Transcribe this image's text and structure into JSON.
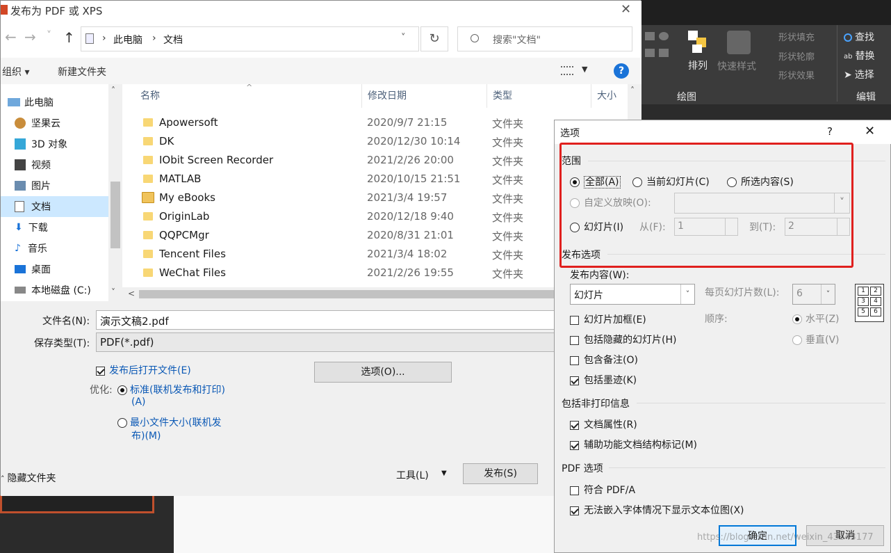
{
  "save_dialog": {
    "title": "发布为 PDF 或 XPS",
    "close": "✕",
    "nav_back": "←",
    "nav_forward": "→",
    "nav_recent": "˅",
    "nav_up": "↑",
    "breadcrumb": [
      "此电脑",
      "文档"
    ],
    "breadcrumb_sep": "›",
    "refresh": "↻",
    "search_placeholder": "搜索\"文档\"",
    "organize": "组织 ▾",
    "new_folder": "新建文件夹",
    "help": "?",
    "nav_items": [
      "此电脑",
      "坚果云",
      "3D 对象",
      "视频",
      "图片",
      "文档",
      "下载",
      "音乐",
      "桌面",
      "本地磁盘 (C:)"
    ],
    "columns": {
      "name": "名称",
      "date": "修改日期",
      "type": "类型",
      "size": "大小"
    },
    "files": [
      {
        "name": "Apowersoft",
        "date": "2020/9/7 21:15",
        "type": "文件夹"
      },
      {
        "name": "DK",
        "date": "2020/12/30 10:14",
        "type": "文件夹"
      },
      {
        "name": "IObit Screen Recorder",
        "date": "2021/2/26 20:00",
        "type": "文件夹"
      },
      {
        "name": "MATLAB",
        "date": "2020/10/15 21:51",
        "type": "文件夹"
      },
      {
        "name": "My eBooks",
        "date": "2021/3/4 19:57",
        "type": "文件夹"
      },
      {
        "name": "OriginLab",
        "date": "2020/12/18 9:40",
        "type": "文件夹"
      },
      {
        "name": "QQPCMgr",
        "date": "2020/8/31 21:01",
        "type": "文件夹"
      },
      {
        "name": "Tencent Files",
        "date": "2021/3/4 18:02",
        "type": "文件夹"
      },
      {
        "name": "WeChat Files",
        "date": "2021/2/26 19:55",
        "type": "文件夹"
      }
    ],
    "filename_label": "文件名(N):",
    "filename_value": "演示文稿2.pdf",
    "filetype_label": "保存类型(T):",
    "filetype_value": "PDF(*.pdf)",
    "open_after": "发布后打开文件(E)",
    "optimize_label": "优化:",
    "opt_standard_1": "标准(联机发布和打印)",
    "opt_standard_2": "(A)",
    "opt_min_1": "最小文件大小(联机发",
    "opt_min_2": "布)(M)",
    "options_button": "选项(O)...",
    "hide_folders": "隐藏文件夹",
    "tools": "工具(L)",
    "tools_arrow": "▼",
    "publish": "发布(S)"
  },
  "ribbon": {
    "arrange": "排列",
    "quick_styles": "快速样式",
    "shape_fill": "形状填充",
    "shape_outline": "形状轮廓",
    "shape_effects": "形状效果",
    "find": "查找",
    "replace": "替换",
    "select": "选择",
    "drawing_group": "绘图",
    "editing_group": "编辑"
  },
  "options_dialog": {
    "title": "选项",
    "help": "?",
    "close": "✕",
    "range_label": "范围",
    "range_all": "全部(A)",
    "range_current": "当前幻灯片(C)",
    "range_selection": "所选内容(S)",
    "custom_show": "自定义放映(O):",
    "slides": "幻灯片(I)",
    "from_label": "从(F):",
    "from_value": "1",
    "to_label": "到(T):",
    "to_value": "2",
    "publish_options": "发布选项",
    "publish_what": "发布内容(W):",
    "publish_what_value": "幻灯片",
    "slides_per_page": "每页幻灯片数(L):",
    "slides_per_page_value": "6",
    "order_label": "顺序:",
    "order_horizontal": "水平(Z)",
    "order_vertical": "垂直(V)",
    "frame_slides": "幻灯片加框(E)",
    "include_hidden": "包括隐藏的幻灯片(H)",
    "include_notes": "包含备注(O)",
    "include_ink": "包括墨迹(K)",
    "non_print_label": "包括非打印信息",
    "doc_properties": "文档属性(R)",
    "accessibility_tags": "辅助功能文档结构标记(M)",
    "pdf_options_label": "PDF 选项",
    "pdf_a": "符合 PDF/A",
    "bitmap_text": "无法嵌入字体情况下显示文本位图(X)",
    "ok": "确定",
    "cancel": "取消",
    "watermark": "https://blog.csdn.net/weixin_43643177",
    "layout_preview": [
      "1",
      "2",
      "3",
      "4",
      "5",
      "6"
    ]
  }
}
